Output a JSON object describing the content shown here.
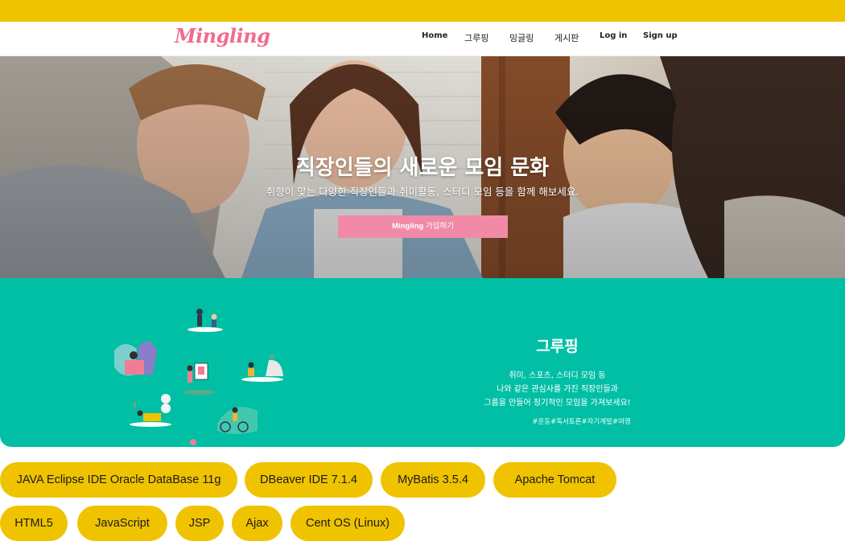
{
  "header": {
    "logo": "Mingling",
    "nav": [
      {
        "label": "Home"
      },
      {
        "label": "그루핑"
      },
      {
        "label": "밍글링"
      },
      {
        "label": "게시판"
      },
      {
        "label": "Log in"
      },
      {
        "label": "Sign up"
      }
    ]
  },
  "hero": {
    "title": "직장인들의 새로운 모임 문화",
    "subtitle": "취향이 맞는 다양한 직장인들과 취미활동, 스터디 모임 등을 함께 해보세요.",
    "cta_brand": "Mingling",
    "cta_label": "가입하기"
  },
  "grouping": {
    "title": "그루핑",
    "lines": [
      "취미, 스포츠, 스터디 모임 등",
      "나와 같은 관심사를 가진 직장인들과",
      "그룹을 만들어 정기적인 모임을 가져보세요!"
    ],
    "tags": "#운동#독서토론#자기계발#여행"
  },
  "tech_stack": [
    "JAVA Eclipse IDE Oracle DataBase 11g",
    "DBeaver IDE 7.1.4",
    "MyBatis 3.5.4",
    "Apache Tomcat",
    "HTML5",
    "JavaScript",
    "JSP",
    "Ajax",
    "Cent OS (Linux)"
  ],
  "colors": {
    "accent_yellow": "#f0c300",
    "brand_pink": "#f06b8f",
    "button_pink": "#f08aa6",
    "teal": "#00bfa5"
  }
}
